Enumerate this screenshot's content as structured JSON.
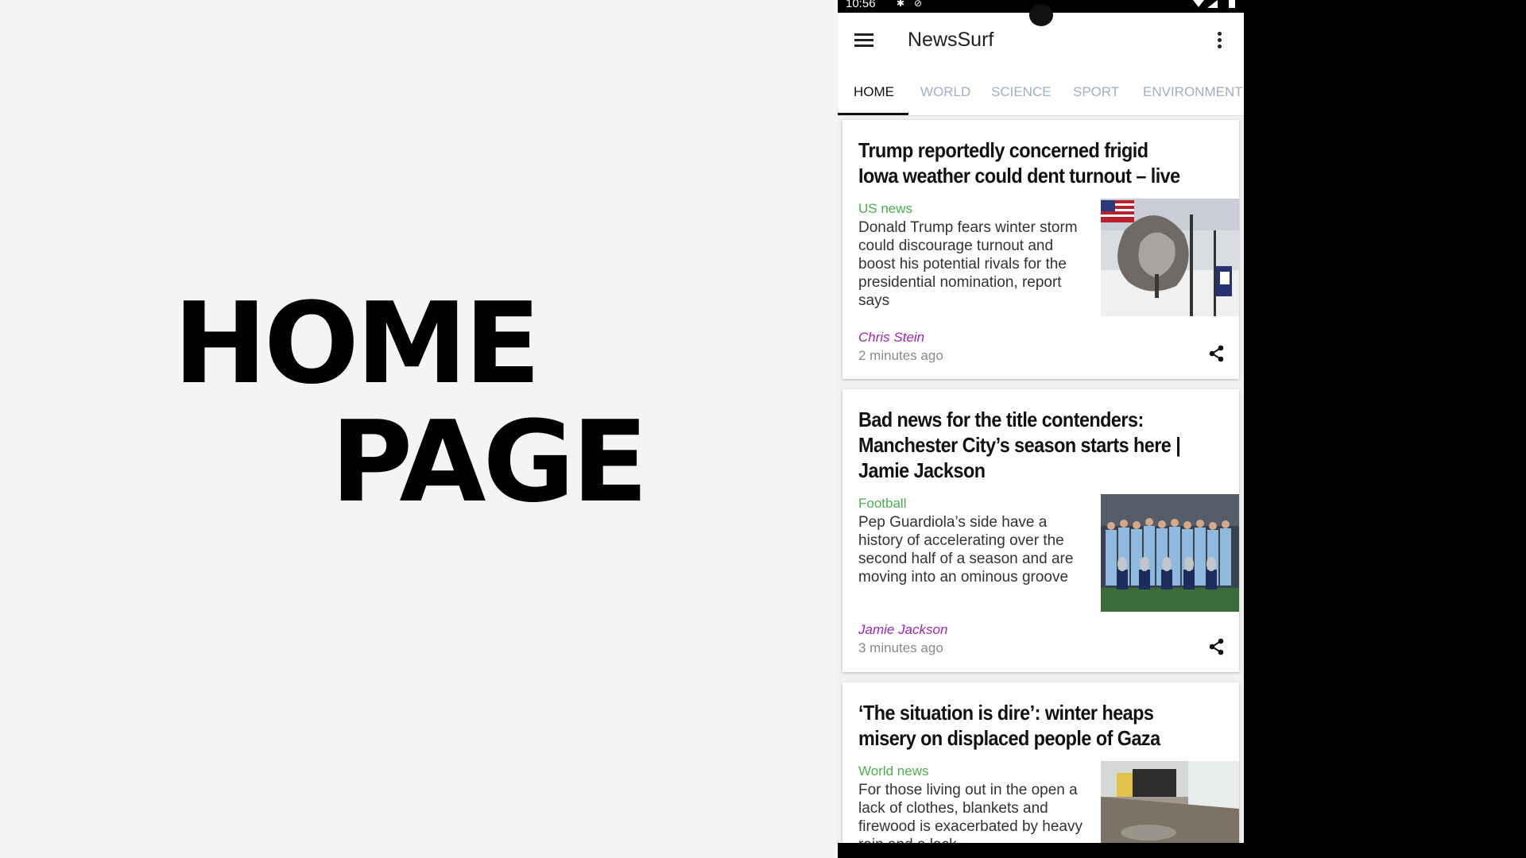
{
  "slide": {
    "line1": "HOME",
    "line2": "PAGE"
  },
  "status": {
    "time": "10:56"
  },
  "app": {
    "title": "NewsSurf"
  },
  "tabs": [
    {
      "label": "HOME"
    },
    {
      "label": "WORLD"
    },
    {
      "label": "SCIENCE"
    },
    {
      "label": "SPORT"
    },
    {
      "label": "ENVIRONMENT"
    }
  ],
  "articles": [
    {
      "headline": "Trump reportedly concerned frigid Iowa weather could dent turnout – live",
      "section": "US news",
      "summary": "Donald Trump fears winter storm could discourage turnout and boost his potential rivals for the presidential nomination, report says",
      "author": "Chris Stein",
      "time": "2 minutes ago"
    },
    {
      "headline": "Bad news for the title contenders: Manchester City’s season starts here | Jamie Jackson",
      "section": "Football",
      "summary": "Pep Guardiola’s side have a history of accelerating over the second half of a season and are moving into an ominous groove",
      "author": "Jamie Jackson",
      "time": "3 minutes ago"
    },
    {
      "headline": "‘The situation is dire’: winter heaps misery on displaced people of Gaza",
      "section": "World news",
      "summary": "For those living out in the open a lack of clothes, blankets and firewood is exacerbated by heavy rain and a lack..."
    }
  ]
}
